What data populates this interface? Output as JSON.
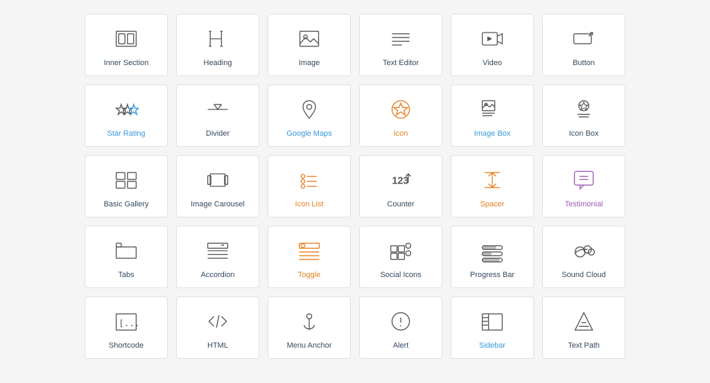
{
  "rows": [
    [
      {
        "id": "inner-section",
        "label": "Inner Section",
        "labelClass": "dark",
        "icon": "inner-section"
      },
      {
        "id": "heading",
        "label": "Heading",
        "labelClass": "dark",
        "icon": "heading"
      },
      {
        "id": "image",
        "label": "Image",
        "labelClass": "dark",
        "icon": "image"
      },
      {
        "id": "text-editor",
        "label": "Text Editor",
        "labelClass": "dark",
        "icon": "text-editor"
      },
      {
        "id": "video",
        "label": "Video",
        "labelClass": "dark",
        "icon": "video"
      },
      {
        "id": "button",
        "label": "Button",
        "labelClass": "dark",
        "icon": "button"
      }
    ],
    [
      {
        "id": "star-rating",
        "label": "Star Rating",
        "labelClass": "blue",
        "icon": "star-rating"
      },
      {
        "id": "divider",
        "label": "Divider",
        "labelClass": "dark",
        "icon": "divider"
      },
      {
        "id": "google-maps",
        "label": "Google Maps",
        "labelClass": "blue",
        "icon": "google-maps"
      },
      {
        "id": "icon",
        "label": "Icon",
        "labelClass": "orange",
        "icon": "icon"
      },
      {
        "id": "image-box",
        "label": "Image Box",
        "labelClass": "blue",
        "icon": "image-box"
      },
      {
        "id": "icon-box",
        "label": "Icon Box",
        "labelClass": "dark",
        "icon": "icon-box"
      }
    ],
    [
      {
        "id": "basic-gallery",
        "label": "Basic Gallery",
        "labelClass": "dark",
        "icon": "basic-gallery"
      },
      {
        "id": "image-carousel",
        "label": "Image Carousel",
        "labelClass": "dark",
        "icon": "image-carousel"
      },
      {
        "id": "icon-list",
        "label": "Icon List",
        "labelClass": "orange",
        "icon": "icon-list"
      },
      {
        "id": "counter",
        "label": "Counter",
        "labelClass": "dark",
        "icon": "counter"
      },
      {
        "id": "spacer",
        "label": "Spacer",
        "labelClass": "orange",
        "icon": "spacer"
      },
      {
        "id": "testimonial",
        "label": "Testimonial",
        "labelClass": "purple",
        "icon": "testimonial"
      }
    ],
    [
      {
        "id": "tabs",
        "label": "Tabs",
        "labelClass": "dark",
        "icon": "tabs"
      },
      {
        "id": "accordion",
        "label": "Accordion",
        "labelClass": "dark",
        "icon": "accordion"
      },
      {
        "id": "toggle",
        "label": "Toggle",
        "labelClass": "orange",
        "icon": "toggle"
      },
      {
        "id": "social-icons",
        "label": "Social Icons",
        "labelClass": "dark",
        "icon": "social-icons"
      },
      {
        "id": "progress-bar",
        "label": "Progress Bar",
        "labelClass": "dark",
        "icon": "progress-bar"
      },
      {
        "id": "sound-cloud",
        "label": "Sound Cloud",
        "labelClass": "dark",
        "icon": "sound-cloud"
      }
    ],
    [
      {
        "id": "shortcode",
        "label": "Shortcode",
        "labelClass": "dark",
        "icon": "shortcode"
      },
      {
        "id": "html",
        "label": "HTML",
        "labelClass": "dark",
        "icon": "html"
      },
      {
        "id": "menu-anchor",
        "label": "Menu Anchor",
        "labelClass": "dark",
        "icon": "menu-anchor"
      },
      {
        "id": "alert",
        "label": "Alert",
        "labelClass": "dark",
        "icon": "alert"
      },
      {
        "id": "sidebar",
        "label": "Sidebar",
        "labelClass": "blue",
        "icon": "sidebar"
      },
      {
        "id": "text-path",
        "label": "Text Path",
        "labelClass": "dark",
        "icon": "text-path"
      }
    ]
  ]
}
